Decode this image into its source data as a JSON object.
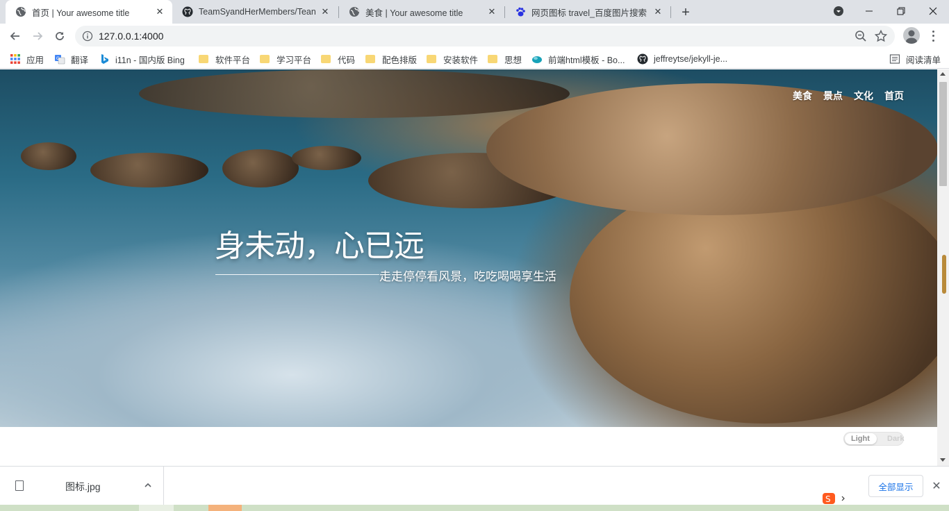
{
  "browser": {
    "tabs": [
      {
        "title": "首页 | Your awesome title",
        "favicon": "globe-icon",
        "active": true
      },
      {
        "title": "TeamSyandHerMembers/Tean",
        "favicon": "github-icon",
        "active": false
      },
      {
        "title": "美食 | Your awesome title",
        "favicon": "globe-icon",
        "active": false
      },
      {
        "title": "网页图标 travel_百度图片搜索",
        "favicon": "baidu-paw-icon",
        "active": false
      }
    ],
    "address": "127.0.0.1:4000",
    "bookmarks": [
      {
        "label": "应用",
        "icon": "apps-grid-icon"
      },
      {
        "label": "翻译",
        "icon": "translate-icon"
      },
      {
        "label": "i11n - 国内版 Bing",
        "icon": "bing-icon"
      },
      {
        "label": "软件平台",
        "icon": "folder-icon"
      },
      {
        "label": "学习平台",
        "icon": "folder-icon"
      },
      {
        "label": "代码",
        "icon": "folder-icon"
      },
      {
        "label": "配色排版",
        "icon": "folder-icon"
      },
      {
        "label": "安装软件",
        "icon": "folder-icon"
      },
      {
        "label": "思想",
        "icon": "folder-icon"
      },
      {
        "label": "前端html模板 - Bo...",
        "icon": "bootstrap-icon"
      },
      {
        "label": "jeffreytse/jekyll-je...",
        "icon": "github-icon"
      }
    ],
    "reading_list": "阅读清单"
  },
  "site": {
    "nav": [
      "美食",
      "景点",
      "文化",
      "首页"
    ],
    "hero_title": "身未动，心已远",
    "hero_subtitle": "走走停停看风景，吃吃喝喝享生活",
    "theme_toggle": {
      "light": "Light",
      "dark": "Dark",
      "selected": "Light"
    }
  },
  "downloads": {
    "file_name": "图标.jpg",
    "show_all": "全部显示"
  },
  "colors": {
    "tabstrip": "#dee1e6",
    "accent": "#1a73e8",
    "folder": "#f8d775"
  }
}
